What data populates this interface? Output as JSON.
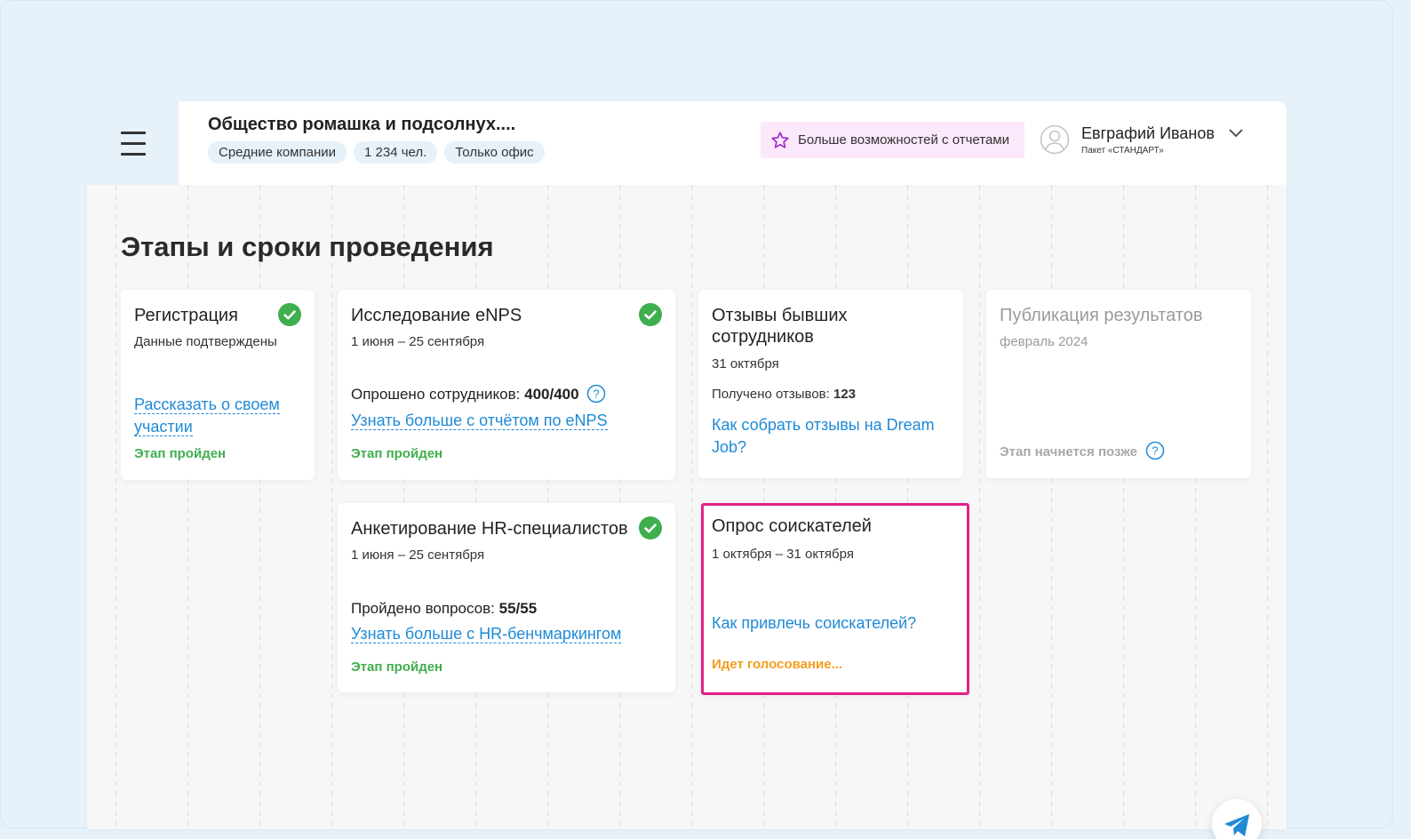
{
  "header": {
    "company_title": "Общество ромашка и подсолнух....",
    "chips": [
      "Средние компании",
      "1 234 чел.",
      "Только офис"
    ],
    "promo_label": "Больше возможностей с отчетами",
    "user_name": "Евграфий Иванов",
    "user_plan": "Пакет «СТАНДАРТ»"
  },
  "page": {
    "title": "Этапы и сроки проведения"
  },
  "stages": {
    "registration": {
      "title": "Регистрация",
      "subtitle": "Данные подтверждены",
      "link": "Рассказать о своем участии",
      "link_line1": "Рассказать о своем",
      "link_line2": "участии",
      "status": "Этап пройден"
    },
    "enps": {
      "title": "Исследование eNPS",
      "dates": "1 июня – 25 сентября",
      "stat_label": "Опрошено сотрудников:",
      "stat_value": "400/400",
      "link": "Узнать больше с отчётом по eNPS",
      "status": "Этап пройден"
    },
    "reviews": {
      "title_line1": "Отзывы бывших",
      "title_line2": "сотрудников",
      "date": "31 октября",
      "stat_label": "Получено отзывов:",
      "stat_value": "123",
      "link_line1": "Как собрать отзывы на Dream",
      "link_line2": "Job?"
    },
    "publication": {
      "title": "Публикация результатов",
      "date": "февраль 2024",
      "status": "Этап начнется позже"
    },
    "hr_survey": {
      "title": "Анкетирование HR-специалистов",
      "dates": "1 июня – 25 сентября",
      "stat_label": "Пройдено вопросов:",
      "stat_value": "55/55",
      "link": "Узнать больше с HR-бенчмаркингом",
      "status": "Этап пройден"
    },
    "candidates": {
      "title": "Опрос соискателей",
      "dates": "1 октября – 31 октября",
      "link": "Как привлечь соискателей?",
      "status": "Идет голосование..."
    }
  },
  "colors": {
    "accent_link": "#1f8ad6",
    "done": "#3fae4e",
    "in_progress": "#f59d1f",
    "highlight_border": "#e0218a",
    "promo_bg": "#fbe8fa"
  }
}
